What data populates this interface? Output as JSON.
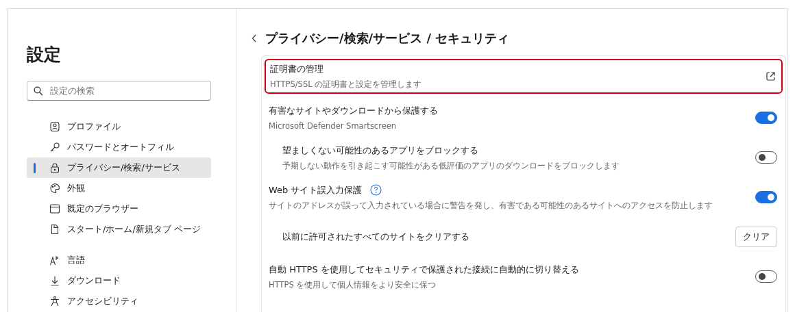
{
  "sidebar": {
    "title": "設定",
    "search": {
      "placeholder": "設定の検索"
    },
    "groups": [
      [
        {
          "label": "プロファイル",
          "selected": false
        },
        {
          "label": "パスワードとオートフィル",
          "selected": false
        },
        {
          "label": "プライバシー/検索/サービス",
          "selected": true
        },
        {
          "label": "外観",
          "selected": false
        },
        {
          "label": "既定のブラウザー",
          "selected": false
        },
        {
          "label": "スタート/ホーム/新規タブ ページ",
          "selected": false
        }
      ],
      [
        {
          "label": "言語",
          "selected": false
        },
        {
          "label": "ダウンロード",
          "selected": false
        },
        {
          "label": "アクセシビリティ",
          "selected": false
        }
      ]
    ]
  },
  "main": {
    "breadcrumb": "プライバシー/検索/サービス / セキュリティ",
    "rows": [
      {
        "kind": "link",
        "title": "証明書の管理",
        "description": "HTTPS/SSL の証明書と設定を管理します",
        "highlighted": true
      },
      {
        "kind": "toggle",
        "title": "有害なサイトやダウンロードから保護する",
        "description": "Microsoft Defender Smartscreen",
        "on": true,
        "children": [
          {
            "kind": "toggle",
            "title": "望ましくない可能性のあるアプリをブロックする",
            "description": "予期しない動作を引き起こす可能性がある低評価のアプリのダウンロードをブロックします",
            "on": false
          }
        ]
      },
      {
        "kind": "toggle",
        "title": "Web サイト誤入力保護",
        "description": "サイトのアドレスが誤って入力されている場合に警告を発し、有害である可能性のあるサイトへのアクセスを防止します",
        "on": true,
        "help": true,
        "children": [
          {
            "kind": "button",
            "title": "以前に許可されたすべてのサイトをクリアする",
            "button": "クリア"
          }
        ]
      },
      {
        "kind": "toggle",
        "title": "自動 HTTPS を使用してセキュリティで保護された接続に自動的に切り替える",
        "description": "HTTPS を使用して個人情報をより安全に保つ",
        "on": false
      }
    ]
  }
}
